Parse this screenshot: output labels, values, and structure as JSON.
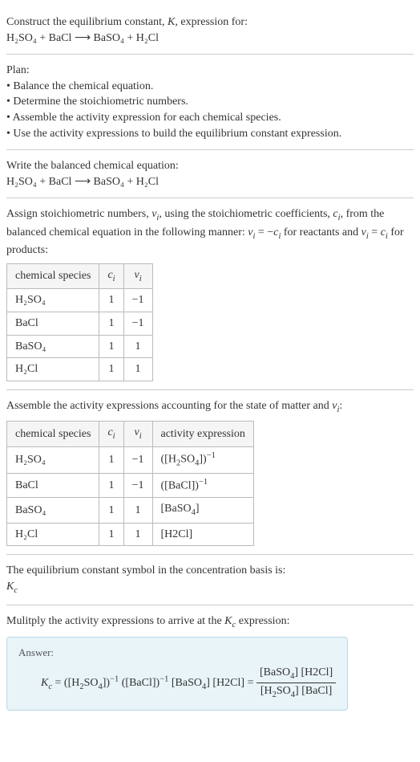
{
  "intro": {
    "line1": "Construct the equilibrium constant, K, expression for:",
    "equation": "H₂SO₄ + BaCl  ⟶  BaSO₄ + H₂Cl"
  },
  "plan": {
    "heading": "Plan:",
    "b1": "• Balance the chemical equation.",
    "b2": "• Determine the stoichiometric numbers.",
    "b3": "• Assemble the activity expression for each chemical species.",
    "b4": "• Use the activity expressions to build the equilibrium constant expression."
  },
  "balanced": {
    "heading": "Write the balanced chemical equation:",
    "equation": "H₂SO₄ + BaCl  ⟶  BaSO₄ + H₂Cl"
  },
  "stoich": {
    "text1": "Assign stoichiometric numbers, νᵢ, using the stoichiometric coefficients, cᵢ, from the balanced chemical equation in the following manner: νᵢ = −cᵢ for reactants and νᵢ = cᵢ for products:",
    "h1": "chemical species",
    "h2": "cᵢ",
    "h3": "νᵢ",
    "rows": [
      [
        "H₂SO₄",
        "1",
        "−1"
      ],
      [
        "BaCl",
        "1",
        "−1"
      ],
      [
        "BaSO₄",
        "1",
        "1"
      ],
      [
        "H₂Cl",
        "1",
        "1"
      ]
    ]
  },
  "activity": {
    "text": "Assemble the activity expressions accounting for the state of matter and νᵢ:",
    "h1": "chemical species",
    "h2": "cᵢ",
    "h3": "νᵢ",
    "h4": "activity expression",
    "rows": [
      [
        "H₂SO₄",
        "1",
        "−1",
        "([H₂SO₄])⁻¹"
      ],
      [
        "BaCl",
        "1",
        "−1",
        "([BaCl])⁻¹"
      ],
      [
        "BaSO₄",
        "1",
        "1",
        "[BaSO₄]"
      ],
      [
        "H₂Cl",
        "1",
        "1",
        "[H2Cl]"
      ]
    ]
  },
  "symbol": {
    "line1": "The equilibrium constant symbol in the concentration basis is:",
    "line2": "K_c"
  },
  "multiply": {
    "text": "Mulitply the activity expressions to arrive at the K_c expression:"
  },
  "answer": {
    "label": "Answer:",
    "lhs": "K_c = ([H₂SO₄])⁻¹ ([BaCl])⁻¹ [BaSO₄] [H2Cl] = ",
    "num": "[BaSO₄] [H2Cl]",
    "den": "[H₂SO₄] [BaCl]"
  },
  "chart_data": {
    "type": "table",
    "tables": [
      {
        "title": "Stoichiometric numbers",
        "columns": [
          "chemical species",
          "c_i",
          "v_i"
        ],
        "rows": [
          {
            "chemical species": "H2SO4",
            "c_i": 1,
            "v_i": -1
          },
          {
            "chemical species": "BaCl",
            "c_i": 1,
            "v_i": -1
          },
          {
            "chemical species": "BaSO4",
            "c_i": 1,
            "v_i": 1
          },
          {
            "chemical species": "H2Cl",
            "c_i": 1,
            "v_i": 1
          }
        ]
      },
      {
        "title": "Activity expressions",
        "columns": [
          "chemical species",
          "c_i",
          "v_i",
          "activity expression"
        ],
        "rows": [
          {
            "chemical species": "H2SO4",
            "c_i": 1,
            "v_i": -1,
            "activity expression": "[H2SO4]^-1"
          },
          {
            "chemical species": "BaCl",
            "c_i": 1,
            "v_i": -1,
            "activity expression": "[BaCl]^-1"
          },
          {
            "chemical species": "BaSO4",
            "c_i": 1,
            "v_i": 1,
            "activity expression": "[BaSO4]"
          },
          {
            "chemical species": "H2Cl",
            "c_i": 1,
            "v_i": 1,
            "activity expression": "[H2Cl]"
          }
        ]
      }
    ],
    "equilibrium_constant": "Kc = [BaSO4][H2Cl] / ([H2SO4][BaCl])"
  }
}
